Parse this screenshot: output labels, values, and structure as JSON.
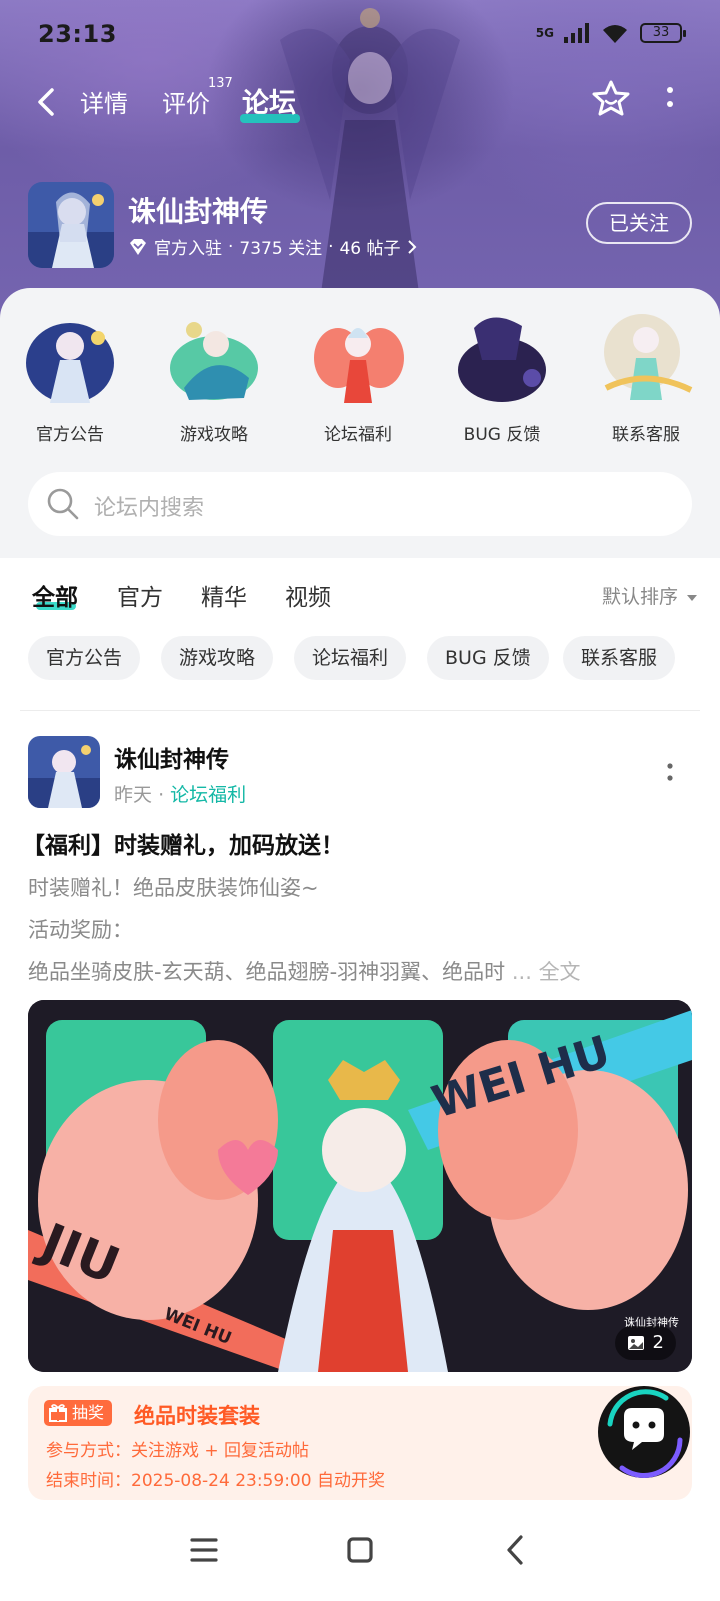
{
  "status_bar": {
    "time": "23:13",
    "network": "5G",
    "battery": "33"
  },
  "nav": {
    "tabs": [
      {
        "label": "详情"
      },
      {
        "label": "评价",
        "badge": "137"
      },
      {
        "label": "论坛",
        "active": true
      }
    ]
  },
  "game": {
    "title": "诛仙封神传",
    "official_tag": "官方入驻",
    "followers": "7375 关注",
    "posts": "46 帖子",
    "follow_label": "已关注"
  },
  "shortcuts": [
    {
      "label": "官方公告"
    },
    {
      "label": "游戏攻略"
    },
    {
      "label": "论坛福利"
    },
    {
      "label": "BUG 反馈"
    },
    {
      "label": "联系客服"
    }
  ],
  "search": {
    "placeholder": "论坛内搜索"
  },
  "filters": {
    "tabs": [
      {
        "label": "全部",
        "active": true
      },
      {
        "label": "官方"
      },
      {
        "label": "精华"
      },
      {
        "label": "视频"
      }
    ],
    "sort_label": "默认排序",
    "chips": [
      "官方公告",
      "游戏攻略",
      "论坛福利",
      "BUG 反馈",
      "联系客服"
    ]
  },
  "post": {
    "author": "诛仙封神传",
    "time": "昨天",
    "board": "论坛福利",
    "title": "【福利】时装赠礼，加码放送！",
    "lines": [
      "时装赠礼！绝品皮肤装饰仙姿~",
      "活动奖励：",
      "绝品坐骑皮肤-玄天葫、绝品翅膀-羽神羽翼、绝品时"
    ],
    "ellipsis": "...",
    "fulltext": "全文",
    "image_count": "2",
    "image_text": {
      "top_right": "WEI HU",
      "bottom_left": "JIU",
      "bottom_small": "WEI HU",
      "logo": "诛仙封神传"
    },
    "lottery": {
      "badge": "抽奖",
      "title": "绝品时装套装",
      "join": "参与方式：关注游戏 + 回复活动帖",
      "end": "结束时间：2025-08-24 23:59:00 自动开奖"
    }
  },
  "colors": {
    "accent": "#19d4c1",
    "board_link": "#14b8a6",
    "lottery": "#ff5a25"
  }
}
